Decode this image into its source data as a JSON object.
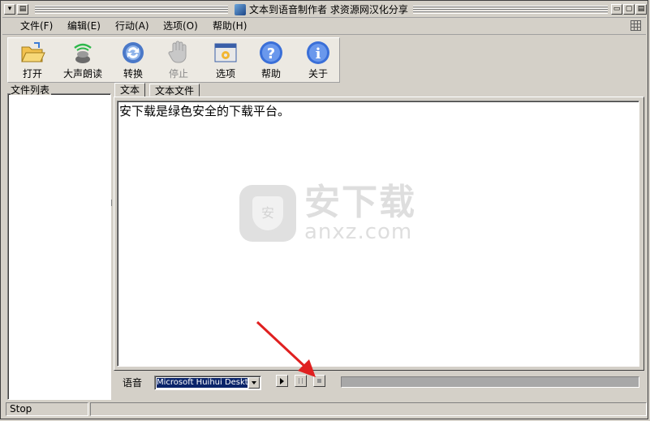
{
  "window": {
    "title": "文本到语音制作者 求资源网汉化分享"
  },
  "menu": {
    "items": [
      "文件(F)",
      "编辑(E)",
      "行动(A)",
      "选项(O)",
      "帮助(H)"
    ]
  },
  "toolbar": {
    "open": "打开",
    "read_aloud": "大声朗读",
    "convert": "转换",
    "stop": "停止",
    "options": "选项",
    "help": "帮助",
    "about": "关于"
  },
  "file_list": {
    "title": "文件列表"
  },
  "tabs": {
    "text": "文本",
    "text_file": "文本文件"
  },
  "editor": {
    "content": "安下载是绿色安全的下载平台。"
  },
  "watermark": {
    "cn": "安下载",
    "en": "anxz.com",
    "badge": "安"
  },
  "voice": {
    "label": "语音",
    "selected": "Microsoft Huihui Desktop"
  },
  "status": {
    "text": "Stop"
  },
  "colors": {
    "window_bg": "#d4d0c8",
    "selection": "#0a246a",
    "arrow": "#e02020"
  }
}
